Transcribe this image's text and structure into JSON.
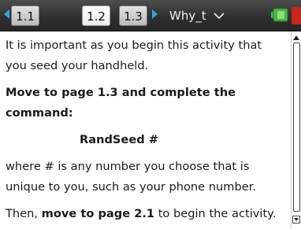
{
  "tabs": [
    {
      "label": "1.1",
      "active": false
    },
    {
      "label": "1.2",
      "active": true
    },
    {
      "label": "1.3",
      "active": false
    }
  ],
  "document": {
    "title": "Why_t"
  },
  "colors": {
    "nav_arrow": "#2fa8e0",
    "battery": "#46b64a",
    "close": "#c8261f"
  },
  "icons": {
    "prev": "nav-left-arrow-icon",
    "next": "nav-right-arrow-icon",
    "menu": "chevron-down-icon",
    "battery": "battery-icon",
    "close": "close-icon"
  },
  "content": {
    "intro_line1": "It is important as you begin this activity that",
    "intro_line2": "you seed your handheld.",
    "heading_line1": "Move to page 1.3 and complete the",
    "heading_line2": "command:",
    "command": "RandSeed #",
    "where_line1": "where # is any number you choose that is",
    "where_line2": "unique to you, such as your phone number.",
    "then_prefix": "Then, ",
    "then_bold": "move to page 2.1",
    "then_suffix": " to begin the activity."
  }
}
